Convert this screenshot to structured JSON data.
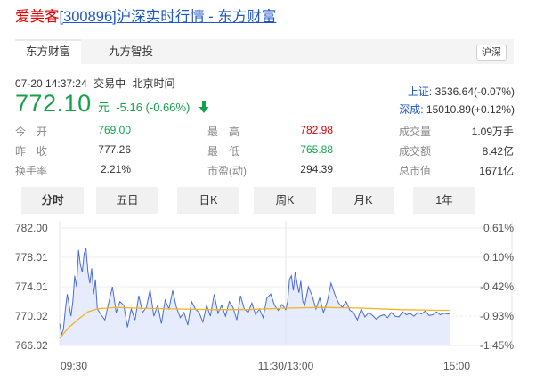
{
  "title": {
    "name": "爱美客",
    "code_market_site": "[300896]沪深实时行情 - 东方财富"
  },
  "tabs": [
    {
      "label": "东方财富",
      "active": true
    },
    {
      "label": "九方智投",
      "active": false
    }
  ],
  "market_badge": "沪深",
  "quote": {
    "datetime": "07-20 14:37:24",
    "status": "交易中",
    "timezone": "北京时间",
    "price": "772.10",
    "unit": "元",
    "change": "-5.16 (-0.66%)",
    "direction": "down"
  },
  "indices": [
    {
      "label": "上证:",
      "value": "3536.64(-0.07%)"
    },
    {
      "label": "深成:",
      "value": "15010.89(+0.12%)"
    }
  ],
  "stats": {
    "col1": [
      {
        "label": "今　开",
        "value": "769.00",
        "color": "green"
      },
      {
        "label": "昨　收",
        "value": "777.26",
        "color": "neutral"
      },
      {
        "label": "换手率",
        "value": "2.21%",
        "color": "neutral"
      }
    ],
    "col2": [
      {
        "label": "最　高",
        "value": "782.98",
        "color": "red"
      },
      {
        "label": "最　低",
        "value": "765.88",
        "color": "green"
      },
      {
        "label": "市盈(动)",
        "value": "294.39",
        "color": "neutral"
      }
    ],
    "col3": [
      {
        "label": "成交量",
        "value": "1.09万手"
      },
      {
        "label": "成交额",
        "value": "8.42亿"
      },
      {
        "label": "总市值",
        "value": "1671亿"
      }
    ]
  },
  "periods": [
    "分时",
    "五日",
    "日K",
    "周K",
    "月K",
    "1年"
  ],
  "active_period": "分时",
  "colors": {
    "up": "#e60000",
    "down": "#13a24a",
    "price_line": "#4a6bd8",
    "area_fill": "#dde5fb",
    "avg_line": "#f2b422",
    "link": "#1d56c8"
  },
  "chart_data": {
    "type": "line",
    "title": "",
    "xlabel": "",
    "ylabel": "",
    "ylim": [
      766.02,
      782.0
    ],
    "prev_close": 777.26,
    "y_ticks_left": [
      "782.00",
      "778.01",
      "774.01",
      "770.02",
      "766.02"
    ],
    "y_ticks_right": [
      "0.61%",
      "0.10%",
      "-0.42%",
      "-0.93%",
      "-1.45%"
    ],
    "x_ticks": [
      "09:30",
      "11:30/13:00",
      "15:00"
    ],
    "x_range_minutes": [
      0,
      240
    ],
    "series": [
      {
        "x": [
          0,
          1,
          2,
          3,
          4,
          5,
          6,
          7,
          8,
          9,
          10,
          11,
          12,
          13,
          14,
          15,
          16,
          17,
          18,
          19,
          20,
          22,
          24,
          26,
          28,
          30,
          32,
          34,
          36,
          38,
          40,
          42,
          44,
          46,
          48,
          50,
          52,
          54,
          56,
          58,
          60,
          62,
          64,
          66,
          68,
          70,
          72,
          74,
          76,
          78,
          80,
          82,
          84,
          86,
          88,
          90,
          92,
          94,
          96,
          98,
          100,
          102,
          104,
          106,
          108,
          110,
          112,
          114,
          116,
          118,
          120,
          121,
          122,
          123,
          124,
          125,
          126,
          127,
          128,
          129,
          130,
          132,
          134,
          136,
          138,
          140,
          142,
          144,
          146,
          148,
          150,
          152,
          154,
          156,
          158,
          160,
          162,
          164,
          166,
          168,
          170,
          172,
          174,
          176,
          178,
          180,
          182,
          184,
          186,
          188,
          190,
          192,
          194,
          196,
          198,
          200,
          202,
          204,
          206,
          207
        ],
        "values": [
          769.0,
          767.5,
          768.2,
          770.8,
          773.0,
          771.5,
          770.0,
          772.0,
          775.5,
          774.0,
          779.0,
          777.0,
          776.0,
          778.5,
          779.2,
          776.0,
          774.5,
          776.5,
          773.0,
          775.0,
          771.0,
          770.2,
          769.5,
          771.8,
          774.0,
          770.5,
          772.0,
          771.5,
          768.5,
          771.0,
          769.5,
          772.8,
          770.5,
          771.2,
          773.6,
          770.0,
          771.5,
          769.0,
          772.2,
          771.0,
          773.5,
          771.2,
          769.8,
          770.5,
          768.8,
          772.0,
          771.0,
          770.5,
          769.2,
          771.5,
          770.0,
          773.0,
          770.4,
          771.5,
          770.0,
          772.0,
          771.2,
          769.5,
          772.8,
          771.0,
          770.5,
          771.8,
          770.2,
          771.0,
          769.8,
          772.5,
          773.0,
          771.5,
          770.8,
          771.6,
          770.9,
          772.0,
          775.0,
          775.5,
          773.5,
          776.0,
          774.5,
          773.2,
          774.8,
          772.0,
          771.5,
          774.0,
          772.8,
          771.0,
          772.5,
          770.5,
          772.0,
          774.5,
          773.0,
          771.8,
          771.2,
          772.0,
          770.8,
          770.5,
          769.5,
          771.0,
          769.9,
          770.5,
          770.1,
          769.6,
          770.0,
          770.2,
          769.8,
          770.5,
          770.0,
          769.9,
          770.6,
          770.2,
          770.4,
          770.0,
          770.5,
          770.3,
          770.7,
          770.1,
          770.2,
          770.6,
          770.2,
          770.4,
          770.3,
          770.3
        ],
        "name": ""
      },
      {
        "x": [
          0,
          5,
          10,
          15,
          20,
          30,
          40,
          60,
          80,
          100,
          120,
          140,
          160,
          180,
          200,
          207
        ],
        "values": [
          767.0,
          768.5,
          769.6,
          770.6,
          771.0,
          771.2,
          771.1,
          771.0,
          770.9,
          770.9,
          771.1,
          771.2,
          771.1,
          770.9,
          770.8,
          770.8
        ],
        "name": ""
      }
    ]
  }
}
